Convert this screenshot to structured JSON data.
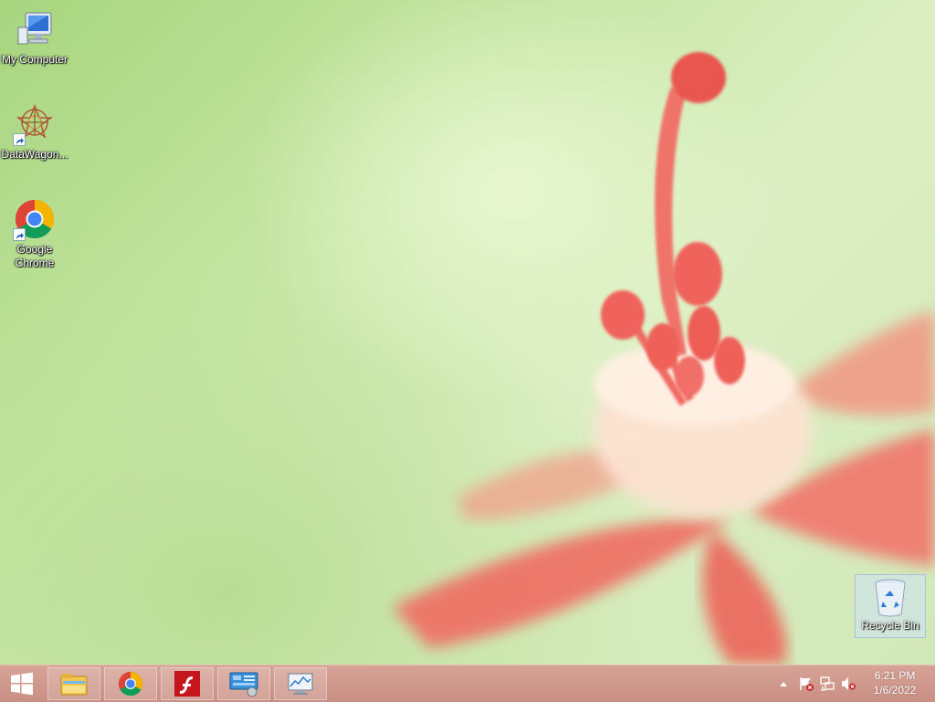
{
  "desktop": {
    "icons": [
      {
        "label": "My Computer",
        "icon": "computer-icon"
      },
      {
        "label": "DataWagon...",
        "icon": "datawagon-icon"
      },
      {
        "label_line1": "Google",
        "label_line2": "Chrome",
        "icon": "chrome-icon"
      }
    ],
    "recycle_bin": {
      "label": "Recycle Bin",
      "icon": "recycle-bin-icon"
    }
  },
  "taskbar": {
    "start_icon": "windows-logo-icon",
    "pinned": [
      {
        "name": "File Explorer",
        "icon": "file-explorer-icon"
      },
      {
        "name": "Google Chrome",
        "icon": "chrome-icon"
      },
      {
        "name": "Flash",
        "icon": "flash-icon"
      },
      {
        "name": "Control Panel",
        "icon": "control-panel-icon"
      },
      {
        "name": "Performance Monitor",
        "icon": "performance-monitor-icon"
      }
    ],
    "tray": {
      "icons": [
        "show-hidden-icons-icon",
        "action-center-flag-icon",
        "network-icon",
        "volume-muted-icon"
      ],
      "time": "6:21 PM",
      "date": "1/6/2022"
    }
  },
  "colors": {
    "taskbar": "#cf998d",
    "wallpaper_green": "#c6e6a4",
    "flower_pink": "#f0705f"
  }
}
